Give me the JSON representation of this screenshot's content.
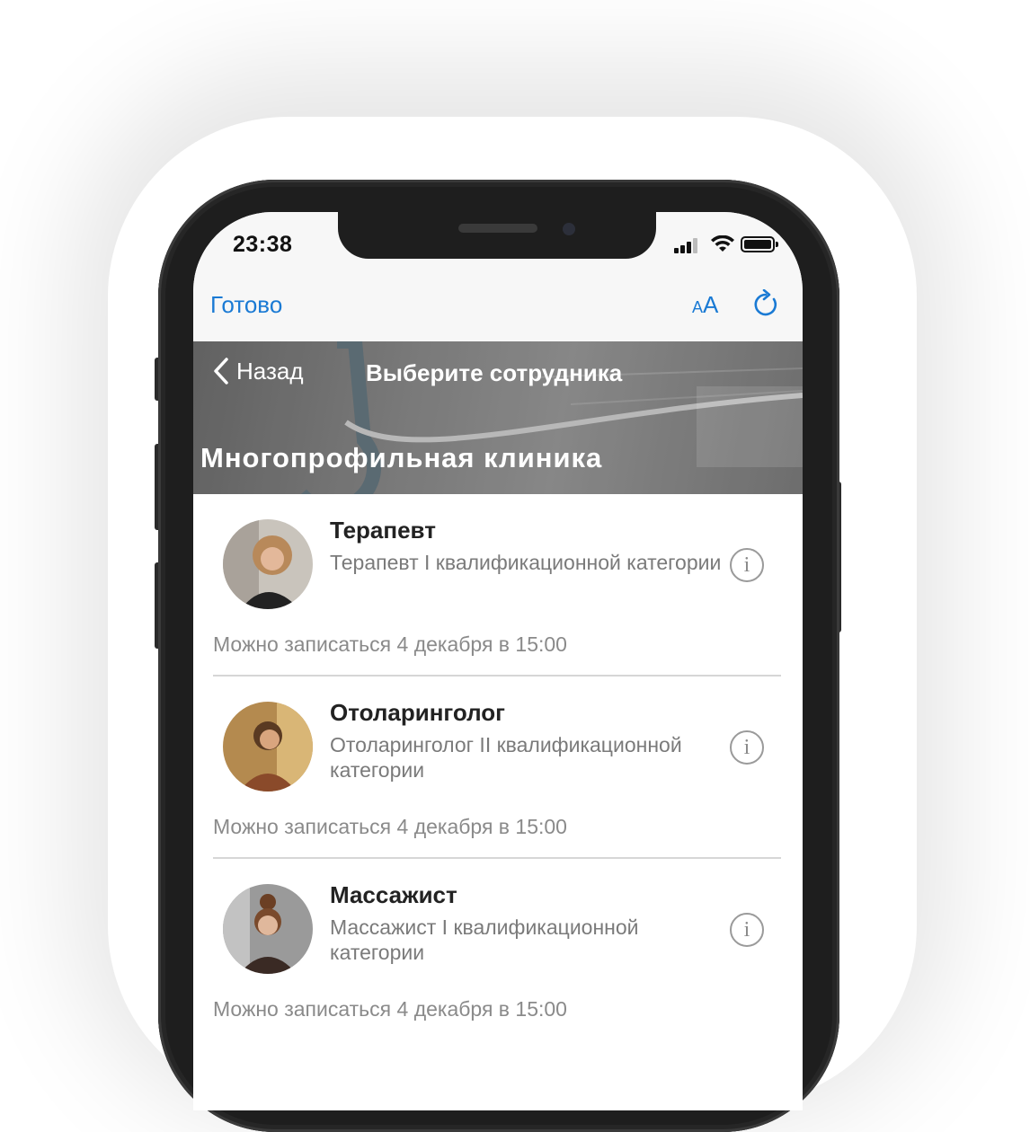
{
  "status_bar": {
    "time": "23:38"
  },
  "toolbar": {
    "done_label": "Готово",
    "text_size_small": "A",
    "text_size_big": "A"
  },
  "nav": {
    "back_label": "Назад",
    "title": "Выберите сотрудника"
  },
  "clinic_title": "Многопрофильная клиника",
  "employees": [
    {
      "role": "Терапевт",
      "description": "Терапевт I квалификационной категории",
      "availability": "Можно записаться 4 декабря в 15:00"
    },
    {
      "role": "Отоларинголог",
      "description": "Отоларинголог II квалификационной категории",
      "availability": "Можно записаться 4 декабря в 15:00"
    },
    {
      "role": "Массажист",
      "description": "Массажист I квалификационной категории",
      "availability": "Можно записаться 4 декабря в 15:00"
    }
  ],
  "info_glyph": "i",
  "colors": {
    "accent": "#1a7ad4",
    "banner": "#8a8a8a",
    "muted_text": "#7a7a7a"
  }
}
